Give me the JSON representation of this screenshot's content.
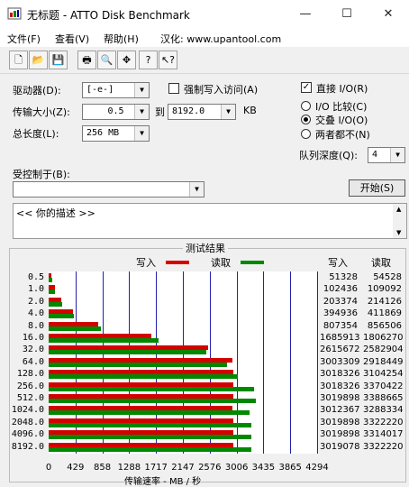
{
  "window": {
    "title": "无标题 - ATTO Disk Benchmark",
    "minimize_glyph": "—",
    "maximize_glyph": "☐",
    "close_glyph": "✕"
  },
  "menu": {
    "file": "文件(F)",
    "view": "查看(V)",
    "help": "帮助(H)",
    "localized": "汉化: www.upantool.com"
  },
  "toolbar": {
    "buttons": [
      {
        "name": "new-file-icon",
        "glyph": "🗋"
      },
      {
        "name": "open-folder-icon",
        "glyph": "📂"
      },
      {
        "name": "save-icon",
        "glyph": "💾"
      },
      {
        "name": "print-icon",
        "glyph": "🖶"
      },
      {
        "name": "print-preview-icon",
        "glyph": "🔍"
      },
      {
        "name": "move-icon",
        "glyph": "✥"
      },
      {
        "name": "help-icon",
        "glyph": "?"
      },
      {
        "name": "context-help-icon",
        "glyph": "↖?"
      }
    ]
  },
  "form": {
    "drive_label": "驱动器(D):",
    "drive_value": "[-e-]",
    "transfer_label": "传输大小(Z):",
    "transfer_from": "0.5",
    "to_label": "到",
    "transfer_to": "8192.0",
    "kb_unit": "KB",
    "total_label": "总长度(L):",
    "total_value": "256 MB",
    "force_write_label": "强制写入访问(A)",
    "force_write_checked": false,
    "direct_io_label": "直接 I/O(R)",
    "direct_io_checked": true,
    "io_compare_label": "I/O 比较(C)",
    "overlap_io_label": "交叠 I/O(O)",
    "neither_label": "两者都不(N)",
    "selected_mode": "overlap",
    "queue_label": "队列深度(Q):",
    "queue_value": "4",
    "controlled_label": "受控制于(B):",
    "controlled_value": "",
    "start_button": "开始(S)",
    "description": "<<  你的描述  >>"
  },
  "results": {
    "group_title": "测试结果",
    "legend_write": "写入",
    "legend_read": "读取",
    "col_write": "写入",
    "col_read": "读取",
    "xlabel": "传输速率 - MB / 秒",
    "colors": {
      "write": "#d40000",
      "read": "#008800",
      "grid": "#2222aa"
    }
  },
  "chart_data": {
    "type": "bar",
    "orientation": "horizontal",
    "categories": [
      "0.5",
      "1.0",
      "2.0",
      "4.0",
      "8.0",
      "16.0",
      "32.0",
      "64.0",
      "128.0",
      "256.0",
      "512.0",
      "1024.0",
      "2048.0",
      "4096.0",
      "8192.0"
    ],
    "series": [
      {
        "name": "写入",
        "values": [
          51328,
          102436,
          203374,
          394936,
          807354,
          1685913,
          2615672,
          3003309,
          3018326,
          3018326,
          3019898,
          3012367,
          3019898,
          3019898,
          3019078
        ]
      },
      {
        "name": "读取",
        "values": [
          54528,
          109092,
          214126,
          411869,
          856506,
          1806270,
          2582904,
          2918449,
          3104254,
          3370422,
          3388665,
          3288334,
          3322220,
          3314017,
          3322220
        ]
      }
    ],
    "value_unit": "KB/s",
    "xticks": [
      "0",
      "429",
      "858",
      "1288",
      "1717",
      "2147",
      "2576",
      "3006",
      "3435",
      "3865",
      "4294"
    ],
    "xlim": [
      0,
      4294
    ],
    "xlabel": "传输速率 - MB / 秒",
    "grid": true,
    "legend": "top"
  }
}
